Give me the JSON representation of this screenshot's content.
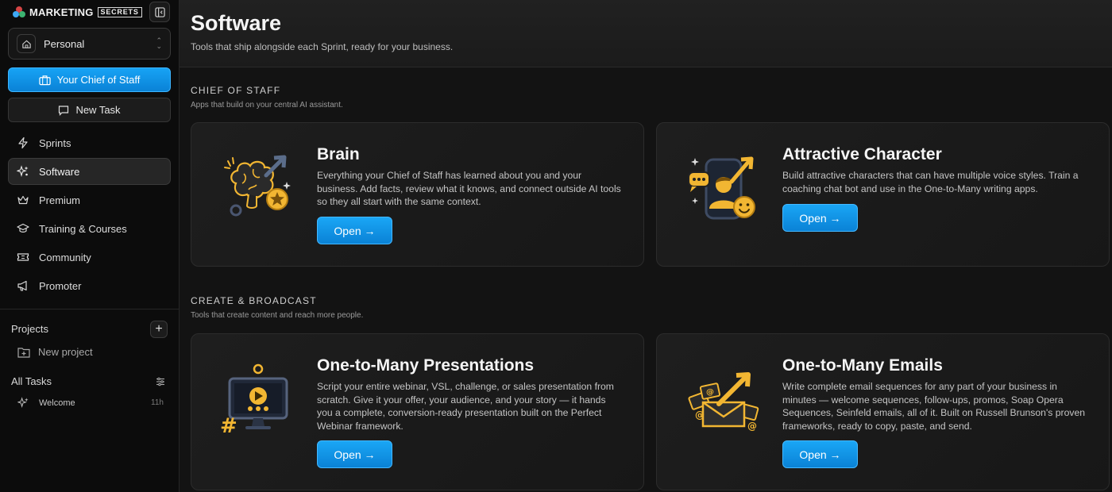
{
  "brand": {
    "name_main": "MARKETING",
    "name_box": "SECRETS"
  },
  "workspace": {
    "label": "Personal"
  },
  "sidebar": {
    "chief_button": "Your Chief of Staff",
    "new_task_button": "New Task",
    "nav": [
      {
        "label": "Sprints",
        "icon": "bolt-icon"
      },
      {
        "label": "Software",
        "icon": "sparkle-icon"
      },
      {
        "label": "Premium",
        "icon": "crown-icon"
      },
      {
        "label": "Training & Courses",
        "icon": "graduation-cap-icon"
      },
      {
        "label": "Community",
        "icon": "ticket-icon"
      },
      {
        "label": "Promoter",
        "icon": "megaphone-icon"
      }
    ],
    "projects_label": "Projects",
    "new_project_label": "New project",
    "all_tasks_label": "All Tasks",
    "tasks": [
      {
        "title": "Welcome",
        "time": "11h"
      }
    ]
  },
  "main": {
    "title": "Software",
    "subtitle": "Tools that ship alongside each Sprint, ready for your business.",
    "sections": [
      {
        "title": "CHIEF OF STAFF",
        "subtitle": "Apps that build on your central AI assistant.",
        "cards": [
          {
            "title": "Brain",
            "description": "Everything your Chief of Staff has learned about you and your business. Add facts, review what it knows, and connect outside AI tools so they all start with the same context.",
            "button": "Open →",
            "icon": "brain-star-icon"
          },
          {
            "title": "Attractive Character",
            "description": "Build attractive characters that can have multiple voice styles. Train a coaching chat bot and use in the One-to-Many writing apps.",
            "button": "Open →",
            "icon": "character-chat-icon"
          }
        ]
      },
      {
        "title": "CREATE & BROADCAST",
        "subtitle": "Tools that create content and reach more people.",
        "cards": [
          {
            "title": "One-to-Many Presentations",
            "description": "Script your entire webinar, VSL, challenge, or sales presentation from scratch. Give it your offer, your audience, and your story — it hands you a complete, conversion-ready presentation built on the Perfect Webinar framework.",
            "button": "Open →",
            "icon": "presentation-monitor-icon"
          },
          {
            "title": "One-to-Many Emails",
            "description": "Write complete email sequences for any part of your business in minutes — welcome sequences, follow-ups, promos, Soap Opera Sequences, Seinfeld emails, all of it. Built on Russell Brunson's proven frameworks, ready to copy, paste, and send.",
            "button": "Open →",
            "icon": "email-envelopes-icon"
          }
        ]
      }
    ]
  },
  "colors": {
    "accent": "#0e8fe4",
    "gold": "#f2b632",
    "background": "#121212"
  }
}
